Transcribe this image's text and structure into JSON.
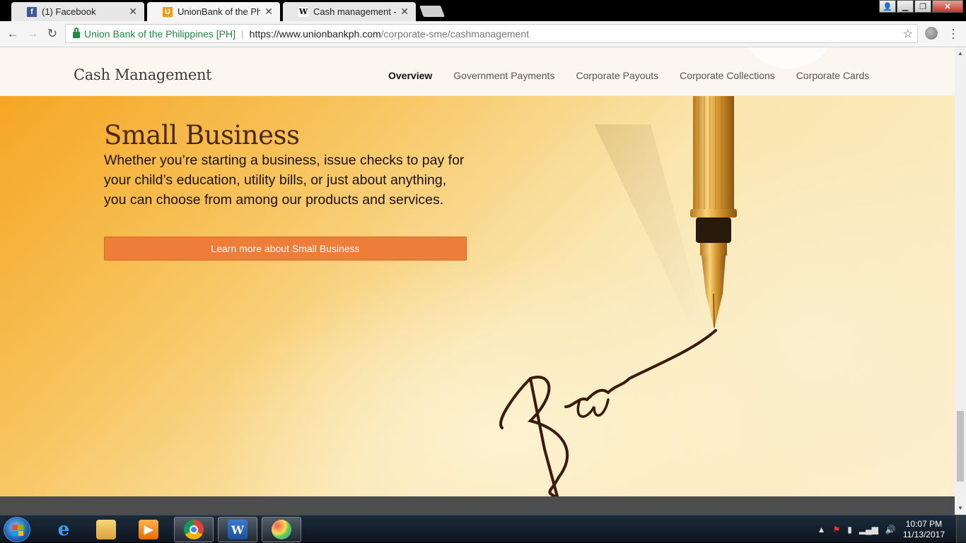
{
  "browser": {
    "tabs": [
      {
        "label": "(1) Facebook",
        "favicon": "facebook-icon",
        "active": false
      },
      {
        "label": "UnionBank of the Philipp",
        "favicon": "unionbank-icon",
        "active": true
      },
      {
        "label": "Cash management - Wik",
        "favicon": "wikipedia-icon",
        "active": false
      }
    ],
    "site_identity": "Union Bank of the Philippines [PH]",
    "url_host": "https://www.unionbankph.com",
    "url_path": "/corporate-sme/cashmanagement"
  },
  "page": {
    "brand": "Cash Management",
    "nav": [
      {
        "label": "Overview",
        "active": true
      },
      {
        "label": "Government Payments",
        "active": false
      },
      {
        "label": "Corporate Payouts",
        "active": false
      },
      {
        "label": "Corporate Collections",
        "active": false
      },
      {
        "label": "Corporate Cards",
        "active": false
      }
    ],
    "hero": {
      "title": "Small Business",
      "text": "Whether you’re starting a business, issue checks to pay for your child’s education, utility bills, or just about anything, you can choose from among our products and services.",
      "cta": "Learn more about Small Business"
    }
  },
  "taskbar": {
    "apps": [
      "internet-explorer",
      "windows-explorer",
      "media-player",
      "chrome",
      "word",
      "paint"
    ],
    "time": "10:07 PM",
    "date": "11/13/2017"
  },
  "colors": {
    "accent_cta": "#ee7d3a",
    "brand_text": "#3a3a3a",
    "hero_title": "#4a2a0c",
    "secure_green": "#1e8e3e"
  }
}
